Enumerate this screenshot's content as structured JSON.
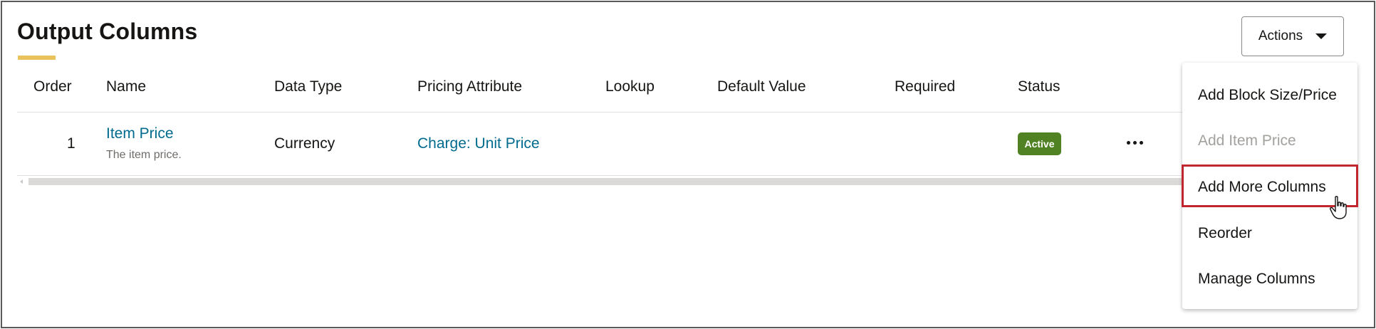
{
  "page": {
    "title": "Output Columns",
    "accent_color": "#e9c25b"
  },
  "actions": {
    "label": "Actions",
    "icon": "caret-down-icon"
  },
  "table": {
    "columns": [
      "Order",
      "Name",
      "Data Type",
      "Pricing Attribute",
      "Lookup",
      "Default Value",
      "Required",
      "Status"
    ],
    "rows": [
      {
        "order": "1",
        "name": "Item Price",
        "description": "The item price.",
        "data_type": "Currency",
        "pricing_attribute": "Charge: Unit Price",
        "lookup": "",
        "default_value": "",
        "required": "",
        "status": "Active",
        "status_color": "#508223",
        "more_icon": "ellipsis-icon"
      }
    ]
  },
  "menu": {
    "items": [
      {
        "label": "Add Block Size/Price",
        "disabled": false
      },
      {
        "label": "Add Item Price",
        "disabled": true
      },
      {
        "label": "Add More Columns",
        "disabled": false,
        "highlighted": true
      },
      {
        "label": "Reorder",
        "disabled": false
      },
      {
        "label": "Manage Columns",
        "disabled": false
      }
    ],
    "highlight_color": "#c0262d"
  },
  "link_color": "#006b8f"
}
